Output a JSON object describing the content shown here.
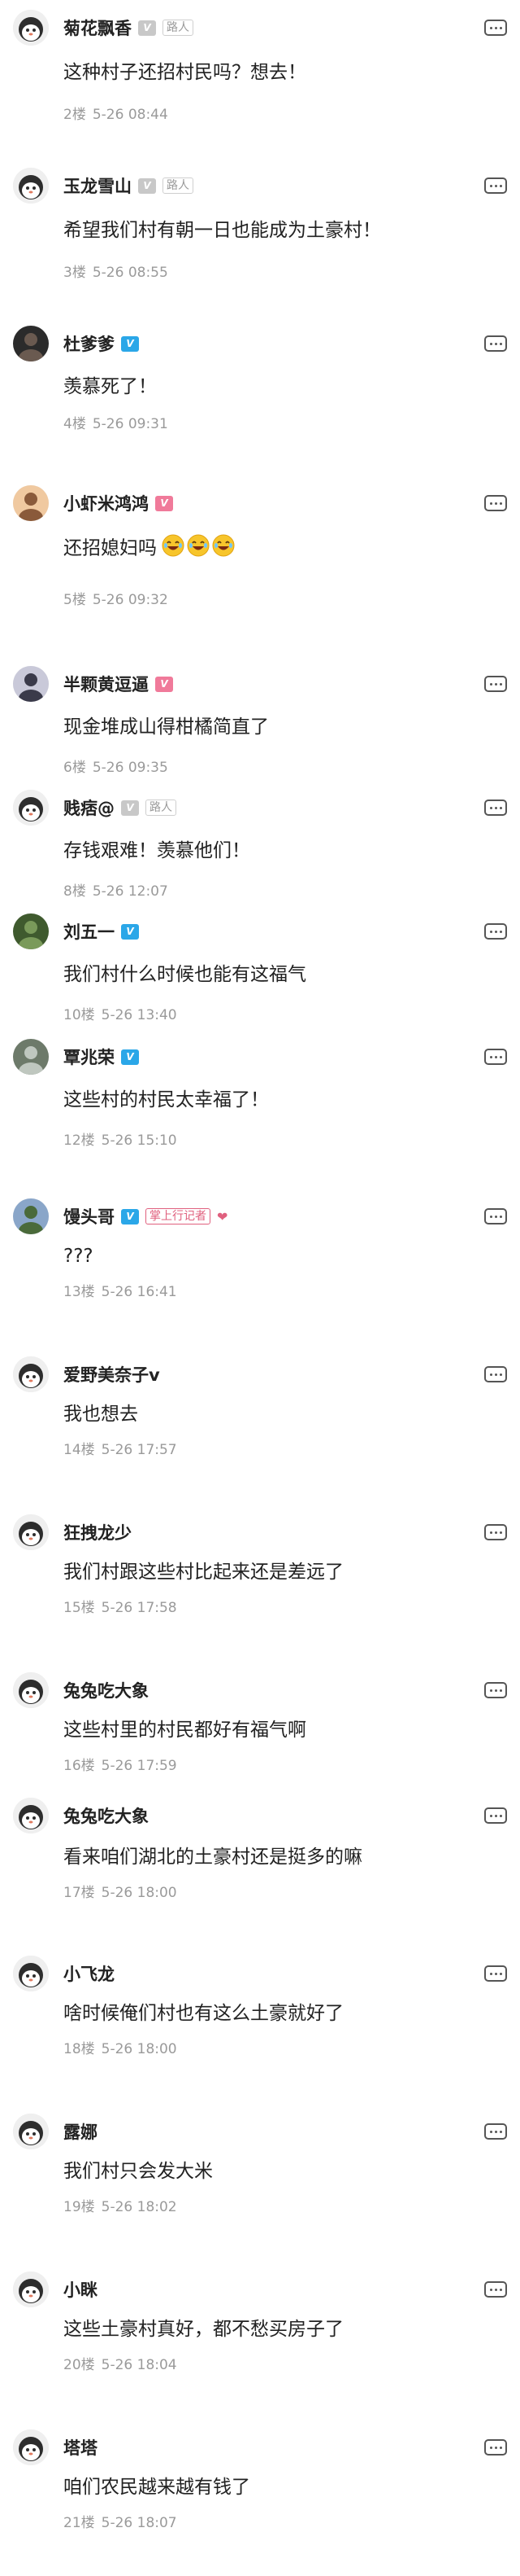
{
  "colors": {
    "badge_gray": "#c8c8c8",
    "badge_blue": "#2ba7e8",
    "badge_pink": "#f07a9a",
    "meta_gray": "#9a9a9a"
  },
  "comments": [
    {
      "name": "菊花飘香",
      "badge": "gray",
      "tag": "路人",
      "text": "这种村子还招村民吗？想去！",
      "floor": "2楼",
      "time": "5-26 08:44",
      "avatar": "default"
    },
    {
      "name": "玉龙雪山",
      "badge": "gray",
      "tag": "路人",
      "text": "希望我们村有朝一日也能成为土豪村！",
      "floor": "3楼",
      "time": "5-26 08:55",
      "avatar": "default"
    },
    {
      "name": "杜爹爹",
      "badge": "blue",
      "text": "羡慕死了！",
      "floor": "4楼",
      "time": "5-26 09:31",
      "avatar": "photo"
    },
    {
      "name": "小虾米鸿鸿",
      "badge": "pink",
      "text": "还招媳妇吗",
      "emoji_count": 3,
      "emoji_icon": "laughing-face-icon",
      "floor": "5楼",
      "time": "5-26 09:32",
      "avatar": "photo"
    },
    {
      "name": "半颗黄逗逼",
      "badge": "pink",
      "text": "现金堆成山得柑橘简直了",
      "floor": "6楼",
      "time": "5-26 09:35",
      "avatar": "photo"
    },
    {
      "name": "贱痞@",
      "badge": "gray",
      "tag": "路人",
      "text": "存钱艰难！羡慕他们！",
      "floor": "8楼",
      "time": "5-26 12:07",
      "avatar": "default"
    },
    {
      "name": "刘五一",
      "badge": "blue",
      "text": "我们村什么时候也能有这福气",
      "floor": "10楼",
      "time": "5-26 13:40",
      "avatar": "photo"
    },
    {
      "name": "覃兆荣",
      "badge": "blue",
      "text": "这些村的村民太幸福了！",
      "floor": "12楼",
      "time": "5-26 15:10",
      "avatar": "photo"
    },
    {
      "name": "馒头哥",
      "badge": "blue",
      "tag": "掌上行记者",
      "heart": "❤",
      "text": "???",
      "floor": "13楼",
      "time": "5-26 16:41",
      "avatar": "photo"
    },
    {
      "name": "爱野美奈子v",
      "text": "我也想去",
      "floor": "14楼",
      "time": "5-26 17:57",
      "avatar": "default"
    },
    {
      "name": "狂拽龙少",
      "text": "我们村跟这些村比起来还是差远了",
      "floor": "15楼",
      "time": "5-26 17:58",
      "avatar": "default"
    },
    {
      "name": "兔兔吃大象",
      "text": "这些村里的村民都好有福气啊",
      "floor": "16楼",
      "time": "5-26 17:59",
      "avatar": "default"
    },
    {
      "name": "兔兔吃大象",
      "text": "看来咱们湖北的土豪村还是挺多的嘛",
      "floor": "17楼",
      "time": "5-26 18:00",
      "avatar": "default"
    },
    {
      "name": "小飞龙",
      "text": "啥时候俺们村也有这么土豪就好了",
      "floor": "18楼",
      "time": "5-26 18:00",
      "avatar": "default"
    },
    {
      "name": "露娜",
      "text": "我们村只会发大米",
      "floor": "19楼",
      "time": "5-26 18:02",
      "avatar": "default"
    },
    {
      "name": "小眯",
      "text": "这些土豪村真好，都不愁买房子了",
      "floor": "20楼",
      "time": "5-26 18:04",
      "avatar": "default"
    },
    {
      "name": "塔塔",
      "text": "咱们农民越来越有钱了",
      "floor": "21楼",
      "time": "5-26 18:07",
      "avatar": "default"
    }
  ]
}
